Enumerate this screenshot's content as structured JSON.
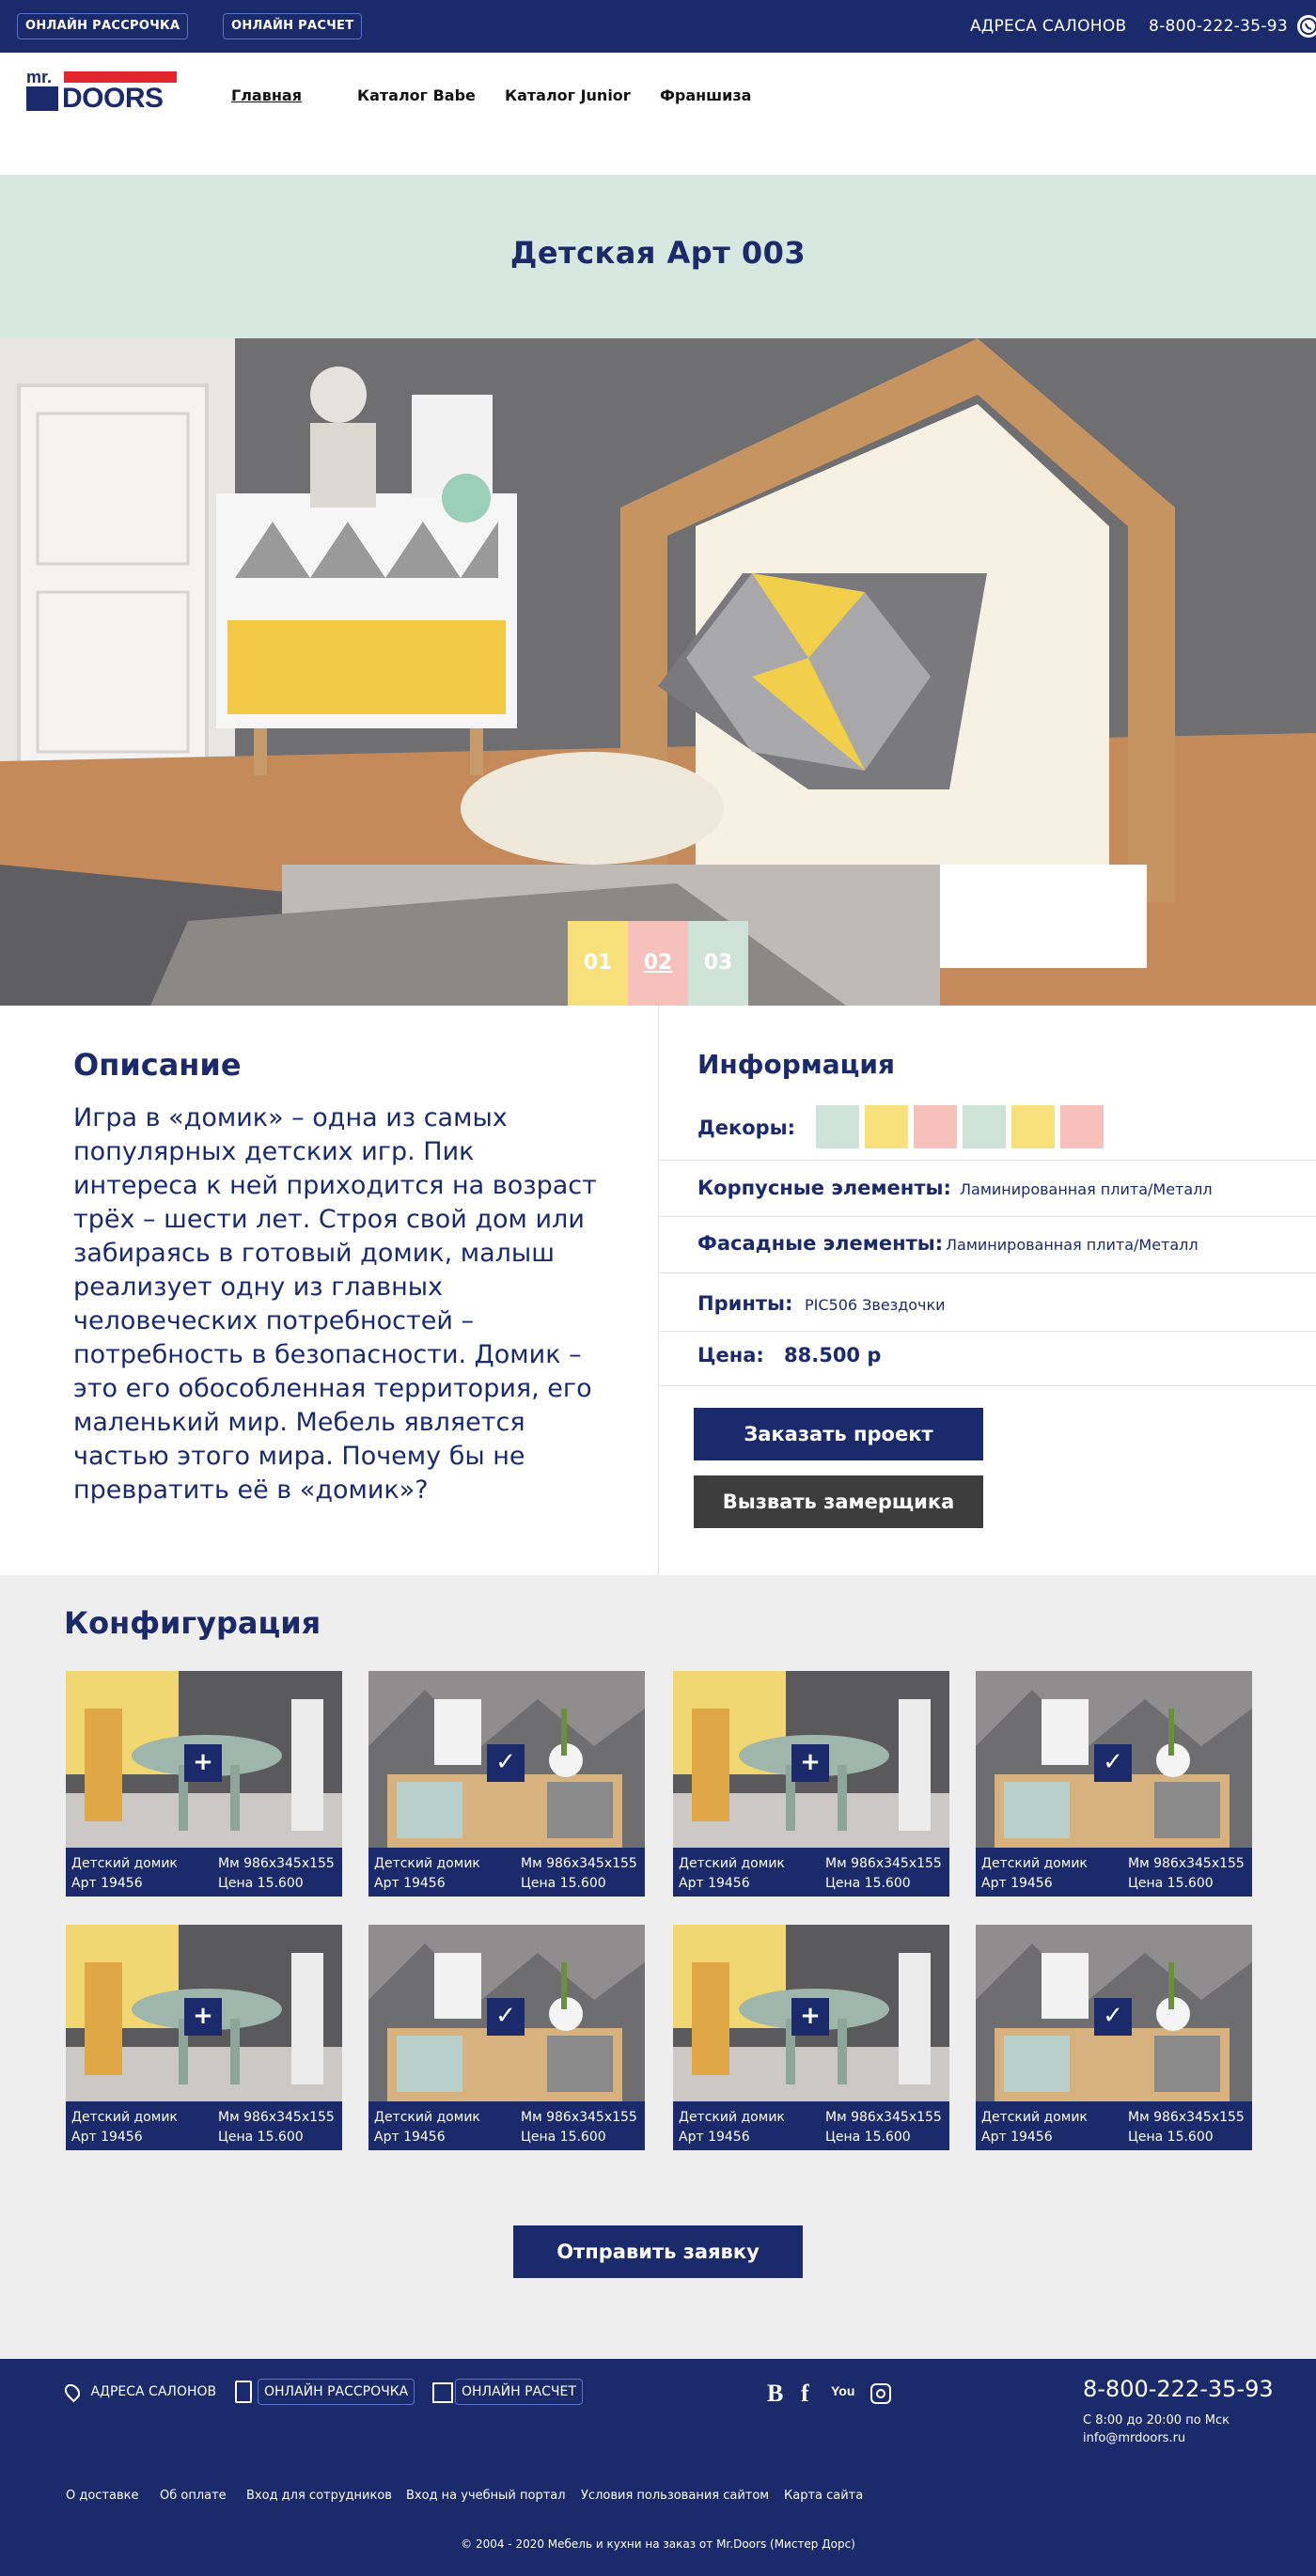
{
  "topbar": {
    "btn_installment": "ОНЛАЙН РАССРОЧКА",
    "btn_calc": "ОНЛАЙН РАСЧЕТ",
    "salons": "АДРЕСА САЛОНОВ",
    "phone": "8-800-222-35-93"
  },
  "header": {
    "logo_mr": "mr.",
    "logo_doors": "DOORS",
    "nav": [
      "Главная",
      "Каталог Babe",
      "Каталог Junior",
      "Франшиза"
    ]
  },
  "page": {
    "title": "Детская Арт 003"
  },
  "slider": {
    "tabs": [
      "01",
      "02",
      "03"
    ],
    "active": "02"
  },
  "description": {
    "title": "Описание",
    "text": "Игра в «домик» – одна из самых популярных детских игр. Пик интереса к ней приходится на возраст трёх – шести лет. Строя свой дом или забираясь в готовый домик, малыш реализует одну из главных человеческих потребностей – потребность в безопасности. Домик – это его обособленная территория, его маленький мир. Мебель является частью этого мира. Почему бы не превратить её в «домик»?"
  },
  "info": {
    "title": "Информация",
    "decor_label": "Декоры:",
    "decor_colors": [
      "#cfe2d9",
      "#f8e07a",
      "#f6c1bb",
      "#cfe2d9",
      "#f8e07a",
      "#f6c1bb"
    ],
    "body_label": "Корпусные элементы:",
    "body_value": "Ламинированная плита/Металл",
    "facade_label": "Фасадные элементы:",
    "facade_value": "Ламинированная плита/Металл",
    "prints_label": "Принты:",
    "prints_value": "PIC506 Звездочки",
    "price_label": "Цена:",
    "price_value": "88.500 р",
    "btn_order": "Заказать проект",
    "btn_measure": "Вызвать замерщика"
  },
  "config": {
    "title": "Конфигурация",
    "items": [
      {
        "name": "Детский домик",
        "art": "Арт 19456",
        "size": "Мм 986x345x155",
        "price": "Цена 15.600",
        "state": "+",
        "kind": "table"
      },
      {
        "name": "Детский домик",
        "art": "Арт 19456",
        "size": "Мм 986x345x155",
        "price": "Цена 15.600",
        "state": "✓",
        "kind": "shelf"
      },
      {
        "name": "Детский домик",
        "art": "Арт 19456",
        "size": "Мм 986x345x155",
        "price": "Цена 15.600",
        "state": "+",
        "kind": "table"
      },
      {
        "name": "Детский домик",
        "art": "Арт 19456",
        "size": "Мм 986x345x155",
        "price": "Цена 15.600",
        "state": "✓",
        "kind": "shelf"
      },
      {
        "name": "Детский домик",
        "art": "Арт 19456",
        "size": "Мм 986x345x155",
        "price": "Цена 15.600",
        "state": "+",
        "kind": "table"
      },
      {
        "name": "Детский домик",
        "art": "Арт 19456",
        "size": "Мм 986x345x155",
        "price": "Цена 15.600",
        "state": "✓",
        "kind": "shelf"
      },
      {
        "name": "Детский домик",
        "art": "Арт 19456",
        "size": "Мм 986x345x155",
        "price": "Цена 15.600",
        "state": "+",
        "kind": "table"
      },
      {
        "name": "Детский домик",
        "art": "Арт 19456",
        "size": "Мм 986x345x155",
        "price": "Цена 15.600",
        "state": "✓",
        "kind": "shelf"
      }
    ],
    "submit": "Отправить заявку"
  },
  "footer": {
    "salons": "АДРЕСА САЛОНОВ",
    "btn_installment": "ОНЛАЙН РАССРОЧКА",
    "btn_calc": "ОНЛАЙН РАСЧЕТ",
    "social_vk": "B",
    "social_fb": "f",
    "social_yt": "You",
    "phone": "8-800-222-35-93",
    "hours": "С 8:00 до 20:00 по Мск",
    "email": "info@mrdoors.ru",
    "links": [
      "О доставке",
      "Об оплате",
      "Вход для сотрудников",
      "Вход на учебный портал",
      "Условия пользования сайтом",
      "Карта сайта"
    ],
    "copyright": "© 2004 - 2020 Мебель и кухни на заказ от Mr.Doors (Мистер Дорс)"
  }
}
